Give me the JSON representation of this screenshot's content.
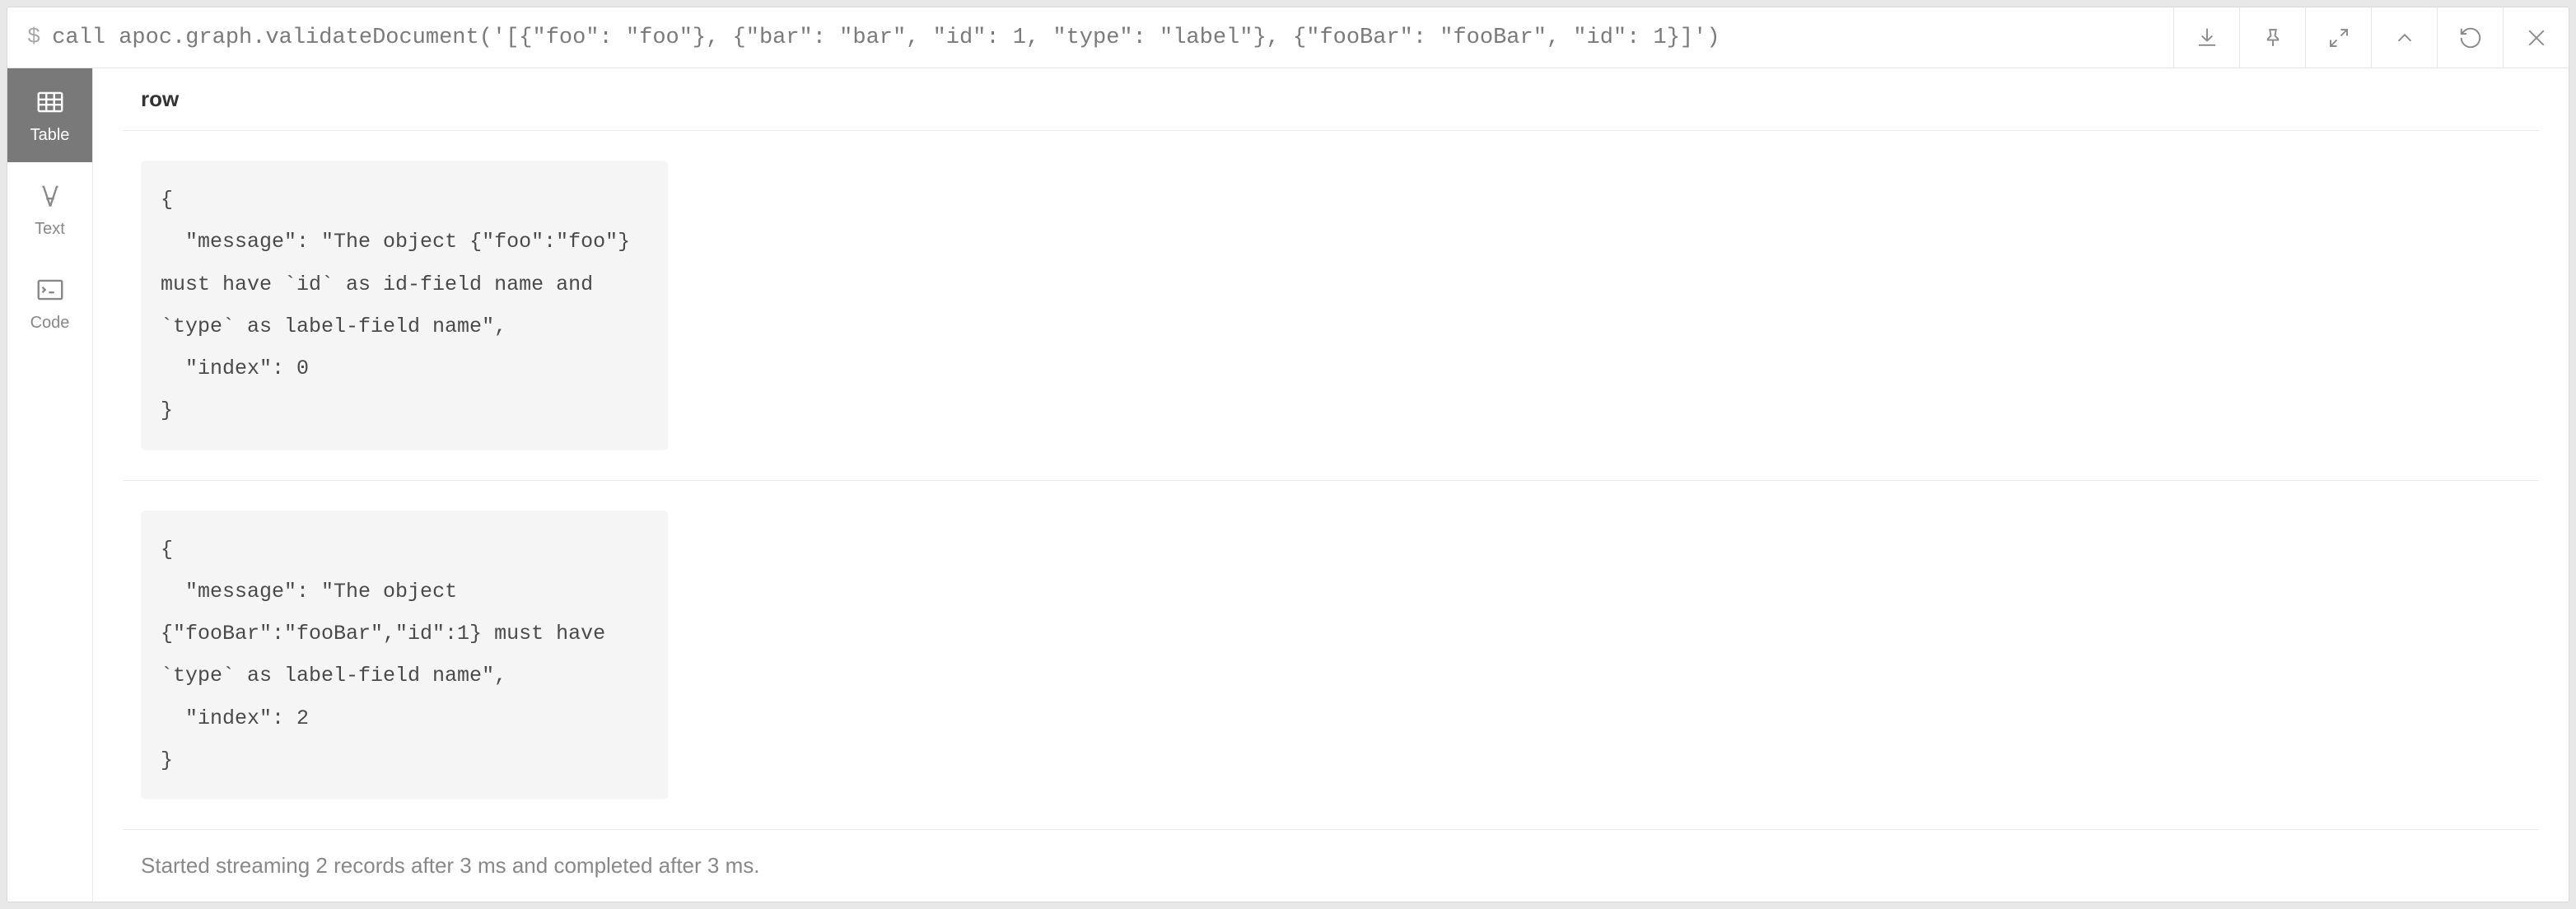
{
  "header": {
    "prompt_symbol": "$",
    "query": "call apoc.graph.validateDocument('[{\"foo\": \"foo\"}, {\"bar\": \"bar\", \"id\": 1, \"type\": \"label\"}, {\"fooBar\": \"fooBar\", \"id\": 1}]')"
  },
  "sidebar": {
    "tabs": [
      {
        "id": "table",
        "label": "Table",
        "active": true
      },
      {
        "id": "text",
        "label": "Text",
        "active": false
      },
      {
        "id": "code",
        "label": "Code",
        "active": false
      }
    ]
  },
  "results": {
    "column_header": "row",
    "rows": [
      "{\n  \"message\": \"The object {\"foo\":\"foo\"} must have `id` as id-field name and `type` as label-field name\",\n  \"index\": 0\n}",
      "{\n  \"message\": \"The object {\"fooBar\":\"fooBar\",\"id\":1} must have `type` as label-field name\",\n  \"index\": 2\n}"
    ]
  },
  "footer": {
    "status": "Started streaming 2 records after 3 ms and completed after 3 ms."
  }
}
